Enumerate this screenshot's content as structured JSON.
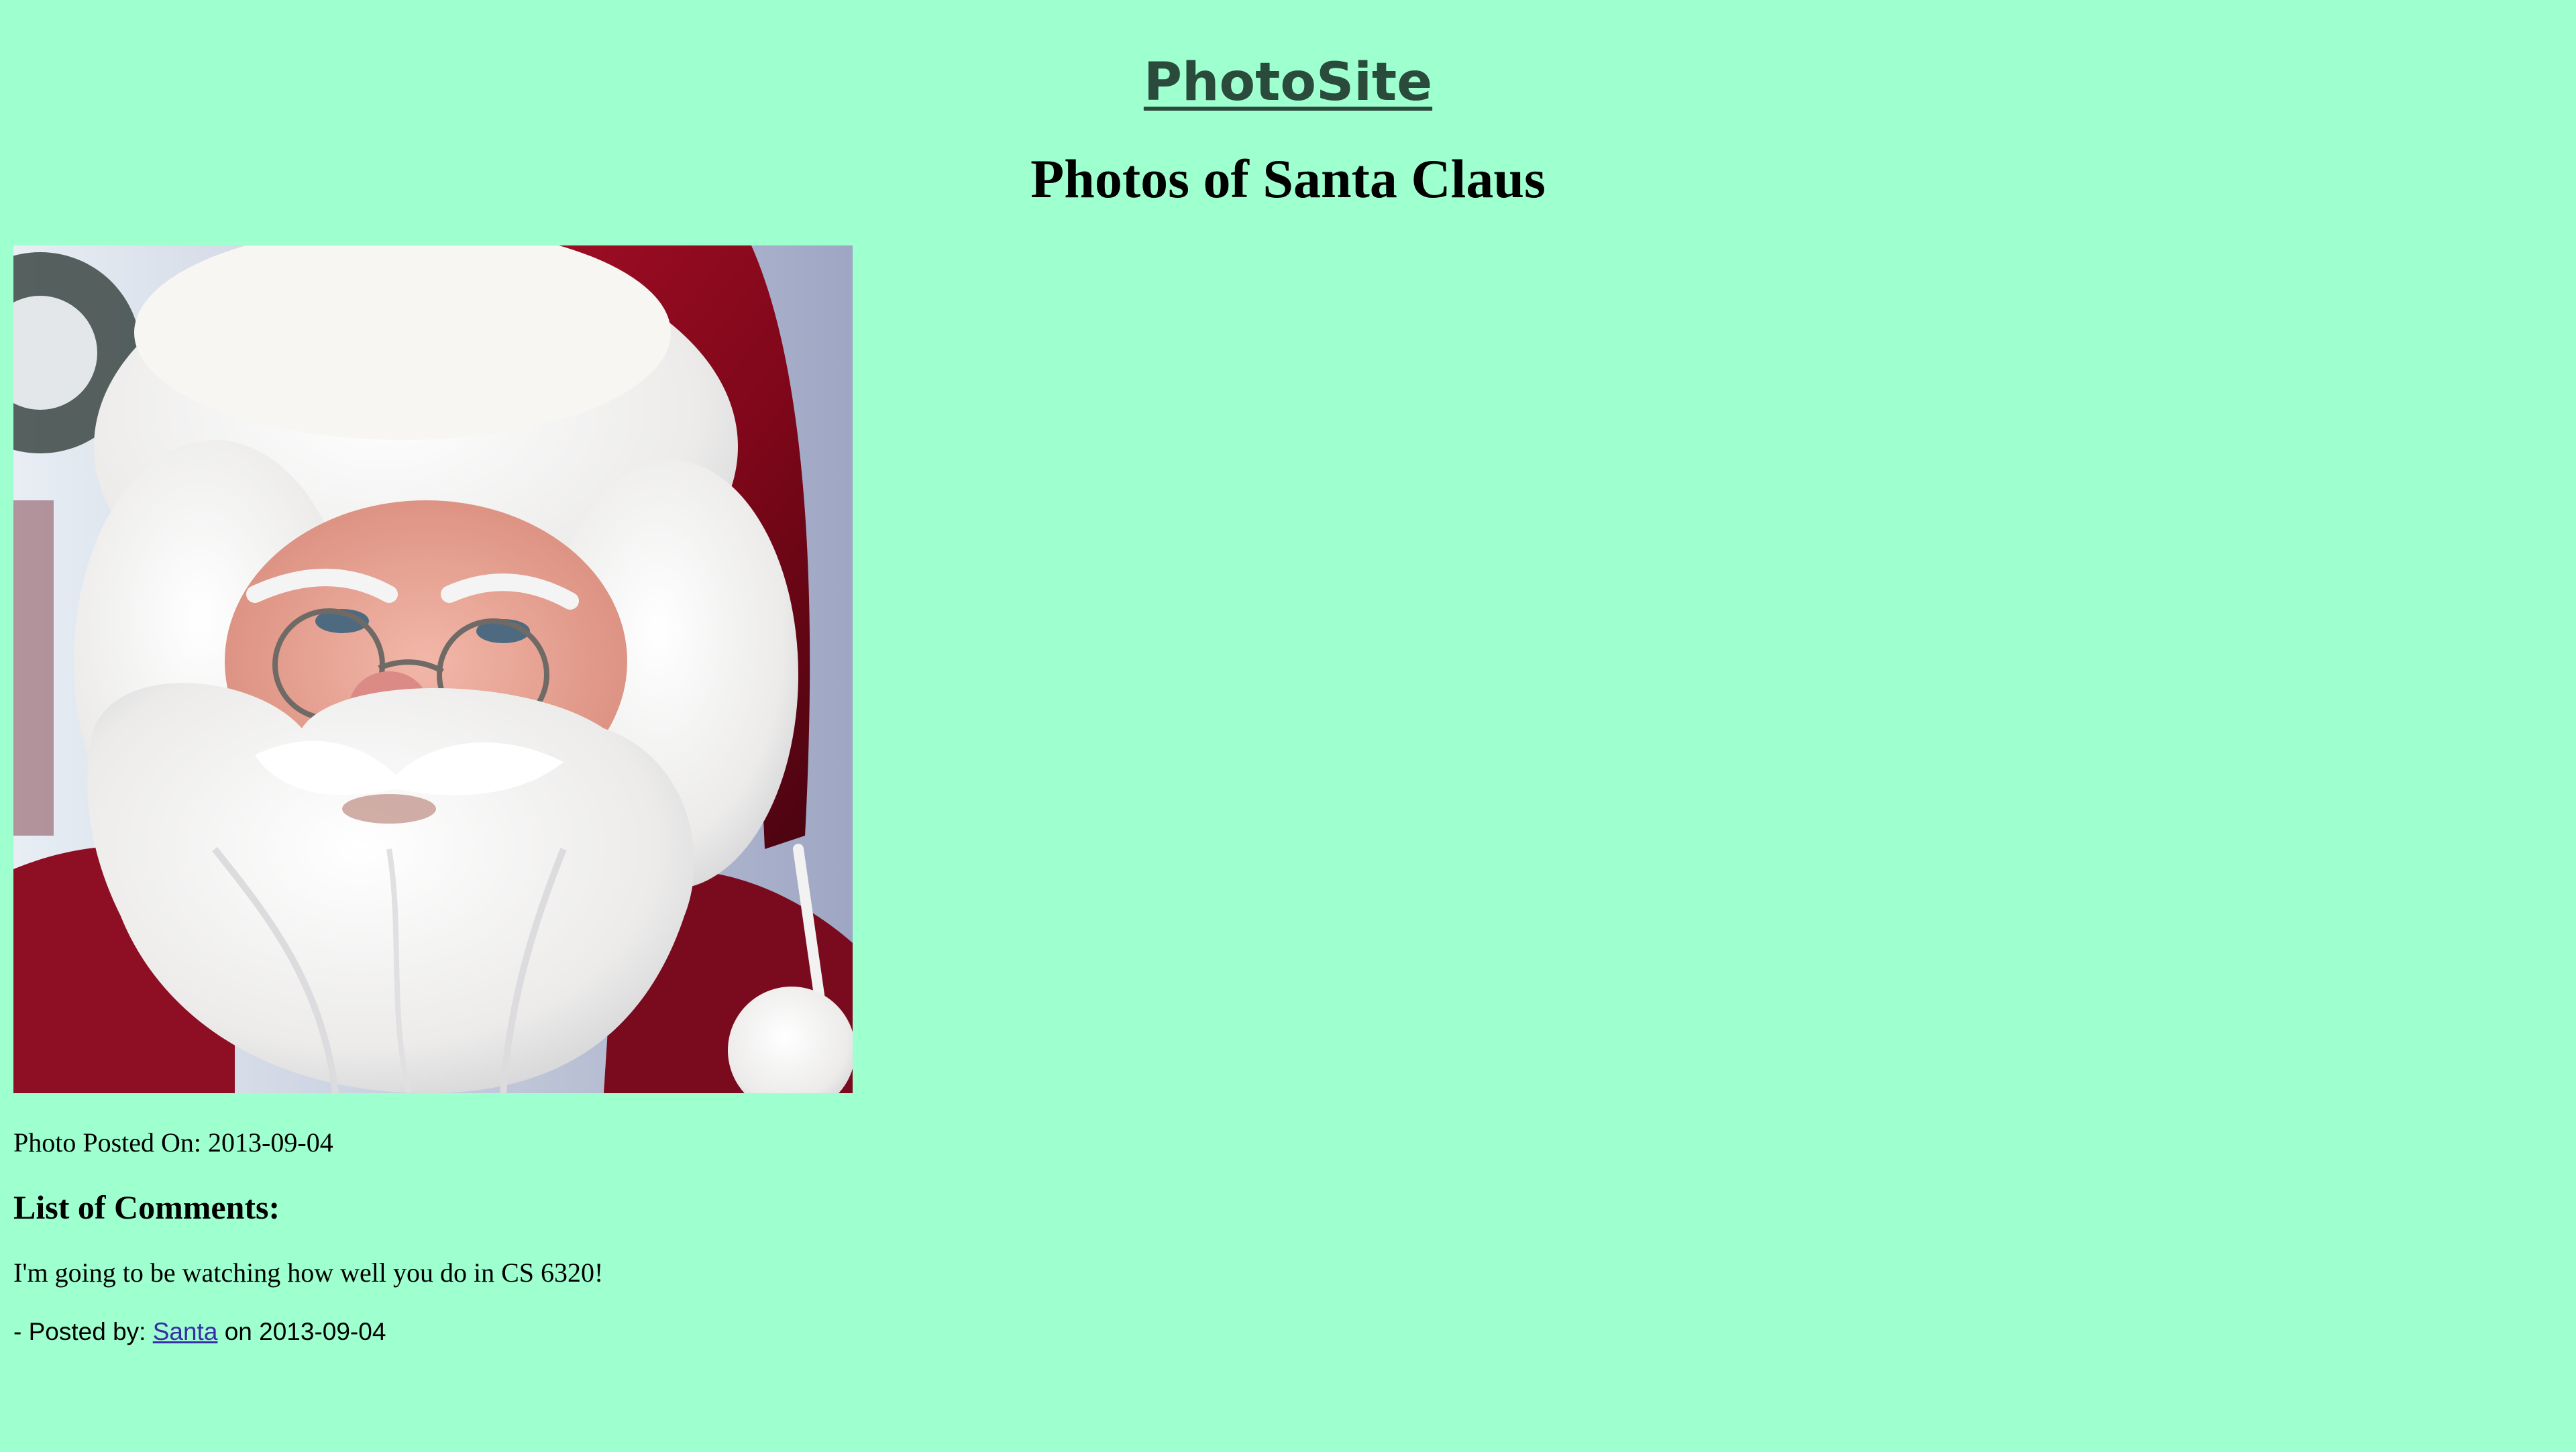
{
  "header": {
    "site_name": "PhotoSite",
    "page_title": "Photos of Santa Claus"
  },
  "photo": {
    "label_prefix": "Photo Posted On:",
    "posted_date": "2013-09-04"
  },
  "comments": {
    "heading": "List of Comments:",
    "items": [
      {
        "text": "I'm going to be watching how well you do in CS 6320!",
        "posted_by_prefix": "- Posted by:",
        "author": "Santa",
        "on_word": "on",
        "date": "2013-09-04"
      }
    ]
  },
  "colors": {
    "background": "#9effcf",
    "site_title": "#2a4a3c",
    "link": "#3a2ba8"
  }
}
